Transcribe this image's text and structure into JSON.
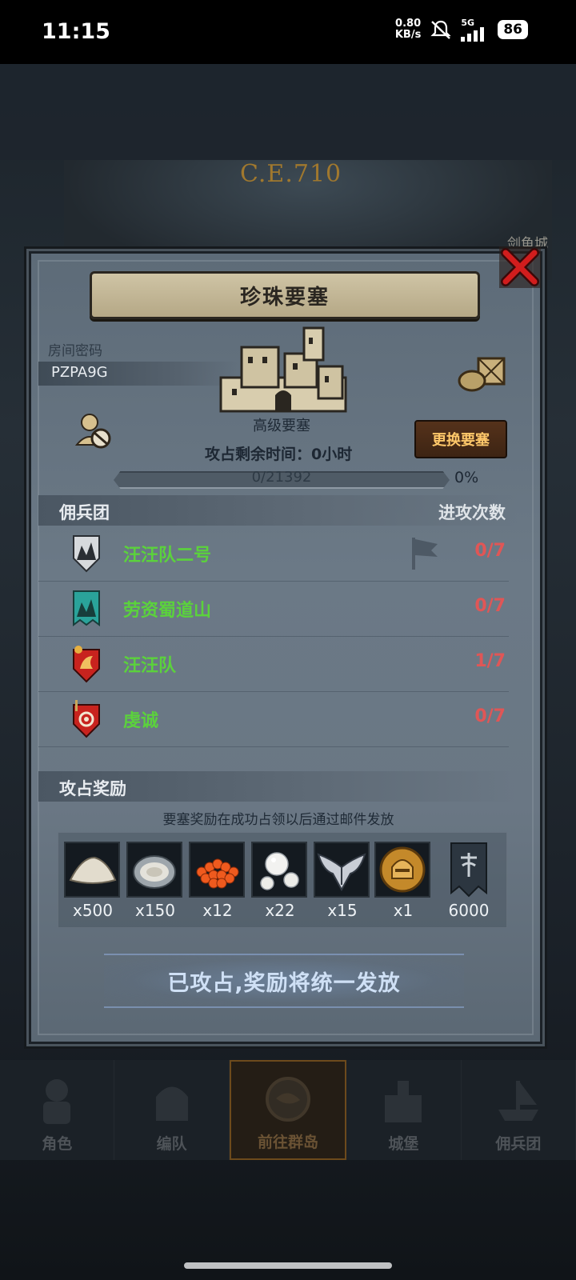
{
  "status_bar": {
    "time": "11:15",
    "net_speed_value": "0.80",
    "net_speed_unit": "KB/s",
    "network": "5G",
    "battery": "86"
  },
  "background": {
    "year": "C.E.710",
    "city_label": "剑鱼城",
    "nav": [
      {
        "label": "角色"
      },
      {
        "label": "编队"
      },
      {
        "label": "前往群岛"
      },
      {
        "label": "城堡"
      },
      {
        "label": "佣兵团"
      }
    ]
  },
  "dialog": {
    "title": "珍珠要塞",
    "room_label": "房间密码",
    "room_code": "PZPA9G",
    "fortress_level": "高级要塞",
    "change_button": "更换要塞",
    "remaining_label": "攻占剩余时间：",
    "remaining_value": "0小时",
    "progress_text": "0/21392",
    "progress_pct": "0%",
    "progress_fraction": 0,
    "merc_header": "佣兵团",
    "attacks_header": "进攻次数",
    "mercenaries": [
      {
        "name": "汪汪队二号",
        "count": "0/7"
      },
      {
        "name": "劳资蜀道山",
        "count": "0/7"
      },
      {
        "name": "汪汪队",
        "count": "1/7"
      },
      {
        "name": "虔诚",
        "count": "0/7"
      }
    ],
    "rewards_header": "攻占奖励",
    "reward_note": "要塞奖励在成功占领以后通过邮件发放",
    "rewards": [
      {
        "icon": "flour-pile-icon",
        "qty": "x500"
      },
      {
        "icon": "oyster-icon",
        "qty": "x150"
      },
      {
        "icon": "caviar-icon",
        "qty": "x12"
      },
      {
        "icon": "pearl-icon",
        "qty": "x22"
      },
      {
        "icon": "wing-emblem-icon",
        "qty": "x15"
      },
      {
        "icon": "gold-helmet-coin-icon",
        "qty": "x1"
      },
      {
        "icon": "guild-banner-icon",
        "qty": "6000"
      }
    ],
    "claim_text": "已攻占,奖励将统一发放"
  }
}
